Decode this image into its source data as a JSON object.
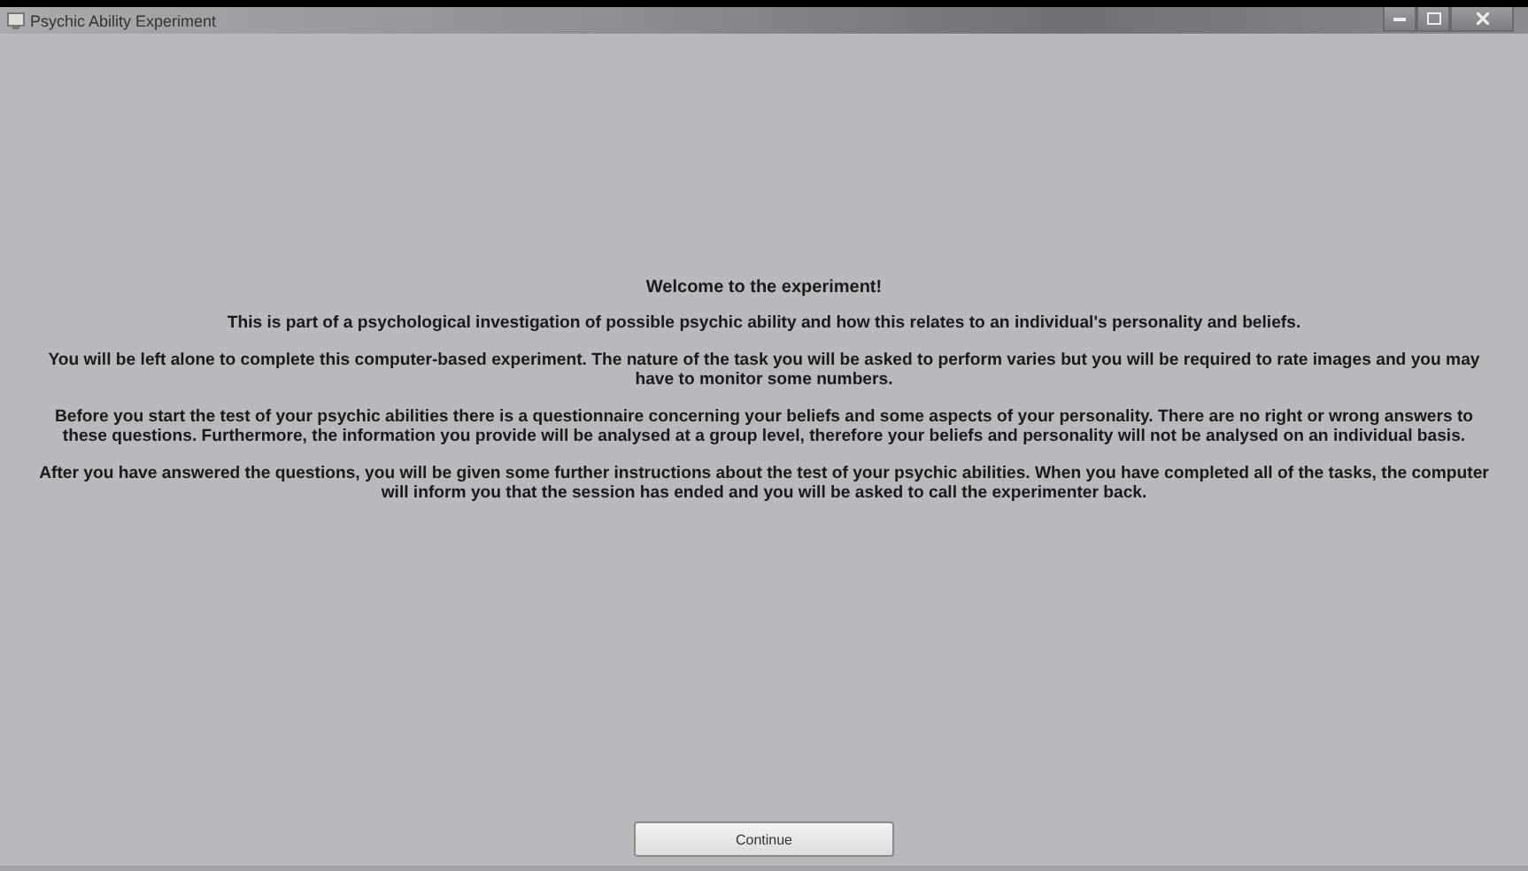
{
  "window": {
    "title": "Psychic Ability Experiment"
  },
  "heading": "Welcome to the experiment!",
  "paragraphs": [
    "This is part of a psychological investigation of possible psychic ability and how this relates to an individual's personality and beliefs.",
    "You will be left alone to complete this computer-based experiment. The nature of the task you will be asked to perform varies but you will be required to rate images and you may have to monitor some numbers.",
    "Before you start the test of your psychic abilities there is a questionnaire concerning your beliefs and some aspects of your personality. There are no right or wrong answers to these questions. Furthermore, the information you provide will be analysed at a group level, therefore your beliefs and personality will not be analysed on an individual basis.",
    "After you have answered the questions, you will be given some further instructions about the test of your psychic abilities. When you have completed all of the tasks, the computer will inform you that the session has ended and you will be asked to call the experimenter back."
  ],
  "buttons": [
    "Continue"
  ]
}
